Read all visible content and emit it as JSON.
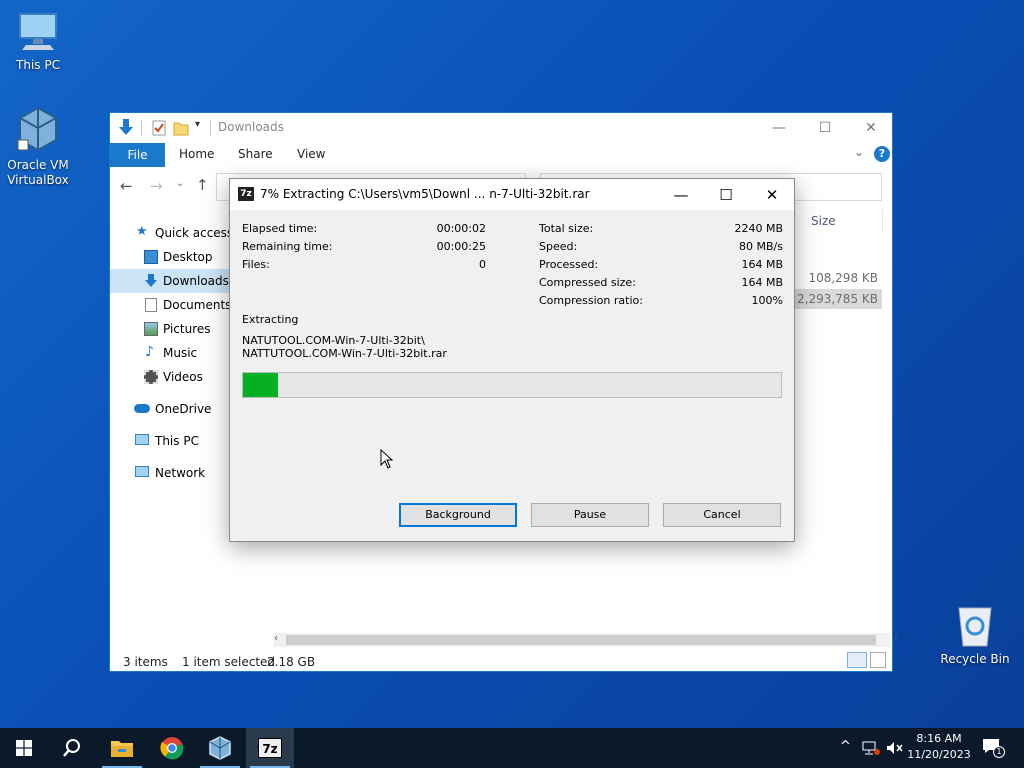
{
  "desktop": {
    "icons": [
      {
        "label": "This PC",
        "icon": "monitor-icon"
      },
      {
        "label": "Oracle VM\nVirtualBox",
        "icon": "virtualbox-icon"
      },
      {
        "label": "Recycle Bin",
        "icon": "recycle-bin-icon"
      }
    ]
  },
  "explorer": {
    "title": "Downloads",
    "ribbon": {
      "file": "File",
      "home": "Home",
      "share": "Share",
      "view": "View"
    },
    "column_size": "Size",
    "sizes": [
      "108,298 KB",
      "2,293,785 KB"
    ],
    "nav": [
      {
        "label": "Quick access",
        "icon": "star-icon"
      },
      {
        "label": "Desktop",
        "icon": "desktop-icon"
      },
      {
        "label": "Downloads",
        "icon": "download-arrow-icon"
      },
      {
        "label": "Documents",
        "icon": "documents-icon"
      },
      {
        "label": "Pictures",
        "icon": "pictures-icon"
      },
      {
        "label": "Music",
        "icon": "music-icon"
      },
      {
        "label": "Videos",
        "icon": "videos-icon"
      },
      {
        "label": "OneDrive",
        "icon": "cloud-icon"
      },
      {
        "label": "This PC",
        "icon": "monitor-icon"
      },
      {
        "label": "Network",
        "icon": "network-icon"
      }
    ],
    "status": {
      "items": "3 items",
      "selected": "1 item selected",
      "size": "2.18 GB"
    }
  },
  "dialog": {
    "app_icon_text": "7z",
    "title": "7% Extracting C:\\Users\\vm5\\Downl ... n-7-Ulti-32bit.rar",
    "left_stats": [
      {
        "label": "Elapsed time:",
        "value": "00:00:02"
      },
      {
        "label": "Remaining time:",
        "value": "00:00:25"
      },
      {
        "label": "Files:",
        "value": "0"
      }
    ],
    "right_stats": [
      {
        "label": "Total size:",
        "value": "2240 MB"
      },
      {
        "label": "Speed:",
        "value": "80 MB/s"
      },
      {
        "label": "Processed:",
        "value": "164 MB"
      },
      {
        "label": "Compressed size:",
        "value": "164 MB"
      },
      {
        "label": "Compression ratio:",
        "value": "100%"
      }
    ],
    "status_label": "Extracting",
    "path_line1": "NATUTOOL.COM-Win-7-Ulti-32bit\\",
    "path_line2": "NATTUTOOL.COM-Win-7-Ulti-32bit.rar",
    "progress_fraction": 0.065,
    "progress_color": "#06b025",
    "buttons": {
      "background": "Background",
      "pause": "Pause",
      "cancel": "Cancel"
    }
  },
  "taskbar": {
    "apps": [
      "start-icon",
      "search-icon",
      "file-explorer-icon",
      "chrome-icon",
      "virtualbox-icon",
      "7zip-icon"
    ],
    "app7z_text": "7z",
    "time": "8:16 AM",
    "date": "11/20/2023",
    "notification_count": "1"
  }
}
